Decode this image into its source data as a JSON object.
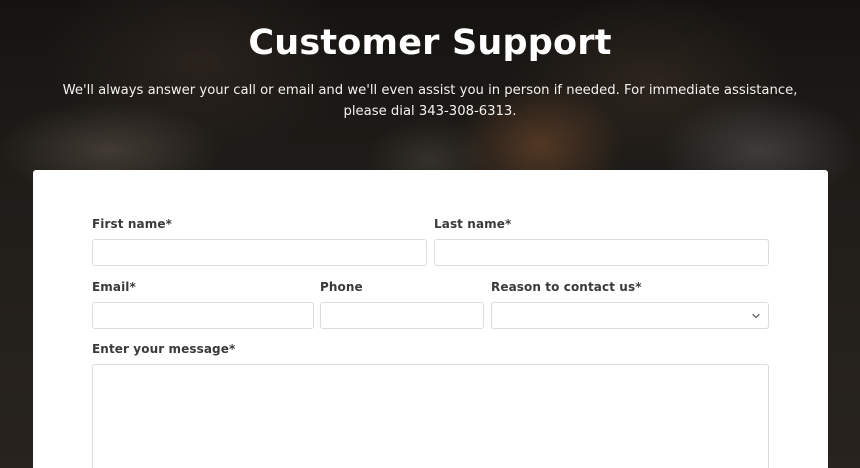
{
  "hero": {
    "title": "Customer Support",
    "subtitle": "We'll always answer your call or email and we'll even assist you in person if needed. For immediate assistance, please dial 343-308-6313."
  },
  "form": {
    "first_name_label": "First name*",
    "first_name_value": "",
    "last_name_label": "Last name*",
    "last_name_value": "",
    "email_label": "Email*",
    "email_value": "",
    "phone_label": "Phone",
    "phone_value": "",
    "reason_label": "Reason to contact us*",
    "reason_selected": "",
    "message_label": "Enter your message*",
    "message_value": ""
  },
  "icons": {
    "reason_dropdown": "chevron-down-icon"
  },
  "colors": {
    "card_background": "#ffffff",
    "input_border": "#dcdcdc",
    "label_text": "#3a3a3a",
    "hero_text": "#ffffff"
  }
}
